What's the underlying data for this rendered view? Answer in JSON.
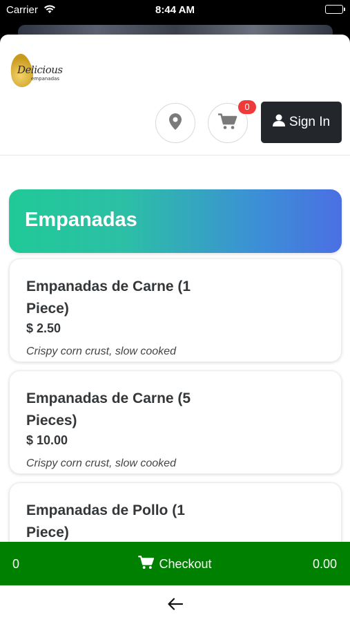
{
  "status_bar": {
    "carrier": "Carrier",
    "time": "8:44 AM",
    "icons": [
      "wifi-icon",
      "battery-icon"
    ]
  },
  "brand": {
    "logo_script": "Delicious",
    "logo_sub": "empanadas"
  },
  "header": {
    "location_icon": "map-pin-icon",
    "cart_icon": "cart-icon",
    "cart_count": "0",
    "signin_label": "Sign In",
    "signin_icon": "user-icon"
  },
  "category": {
    "title": "Empanadas",
    "gradient": [
      "#20c997",
      "#4b6fe3"
    ]
  },
  "products": [
    {
      "name": "Empanadas de Carne (1 Piece)",
      "price": "$ 2.50",
      "description": "Crispy corn crust, slow cooked"
    },
    {
      "name": "Empanadas de Carne (5 Pieces)",
      "price": "$ 10.00",
      "description": "Crispy corn crust, slow cooked"
    },
    {
      "name": "Empanadas de Pollo (1 Piece)",
      "price": "",
      "description": ""
    }
  ],
  "checkout_bar": {
    "item_count": "0",
    "label": "Checkout",
    "total": "0.00",
    "color": "#008000"
  },
  "bottom_nav": {
    "back_icon": "arrow-left-icon"
  },
  "colors": {
    "badge": "#f03a3a",
    "signin_bg": "#23272b"
  }
}
